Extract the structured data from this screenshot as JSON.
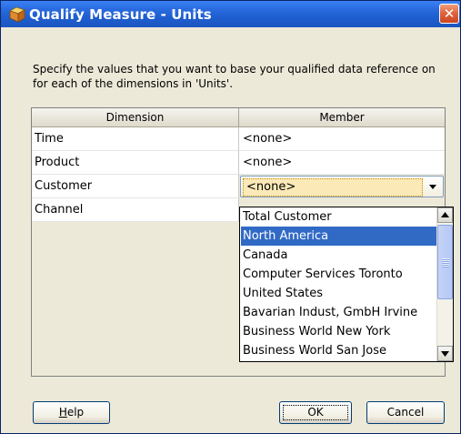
{
  "window": {
    "title": "Qualify Measure - Units",
    "close_symbol": "✕",
    "title_icon": "measure-cube-icon"
  },
  "instructions": "Specify the values that you want to base your qualified data reference on for each of the dimensions in 'Units'.",
  "table": {
    "headers": [
      "Dimension",
      "Member"
    ],
    "rows": [
      {
        "dimension": "Time",
        "member": "<none>"
      },
      {
        "dimension": "Product",
        "member": "<none>"
      },
      {
        "dimension": "Customer",
        "member": "<none>"
      },
      {
        "dimension": "Channel",
        "member": ""
      }
    ]
  },
  "dropdown": {
    "selected_index": 1,
    "items": [
      "Total Customer",
      "North America",
      "Canada",
      "Computer Services Toronto",
      "United States",
      "Bavarian Indust, GmbH Irvine",
      "Business World New York",
      "Business World San Jose"
    ],
    "scroll_position": 0.1
  },
  "buttons": {
    "help_mnemonic": "H",
    "help_rest": "elp",
    "ok": "OK",
    "cancel": "Cancel"
  },
  "colors": {
    "titlebar": "#1F5FD0",
    "selection": "#316AC5",
    "dialog_bg": "#ECE9D8"
  }
}
